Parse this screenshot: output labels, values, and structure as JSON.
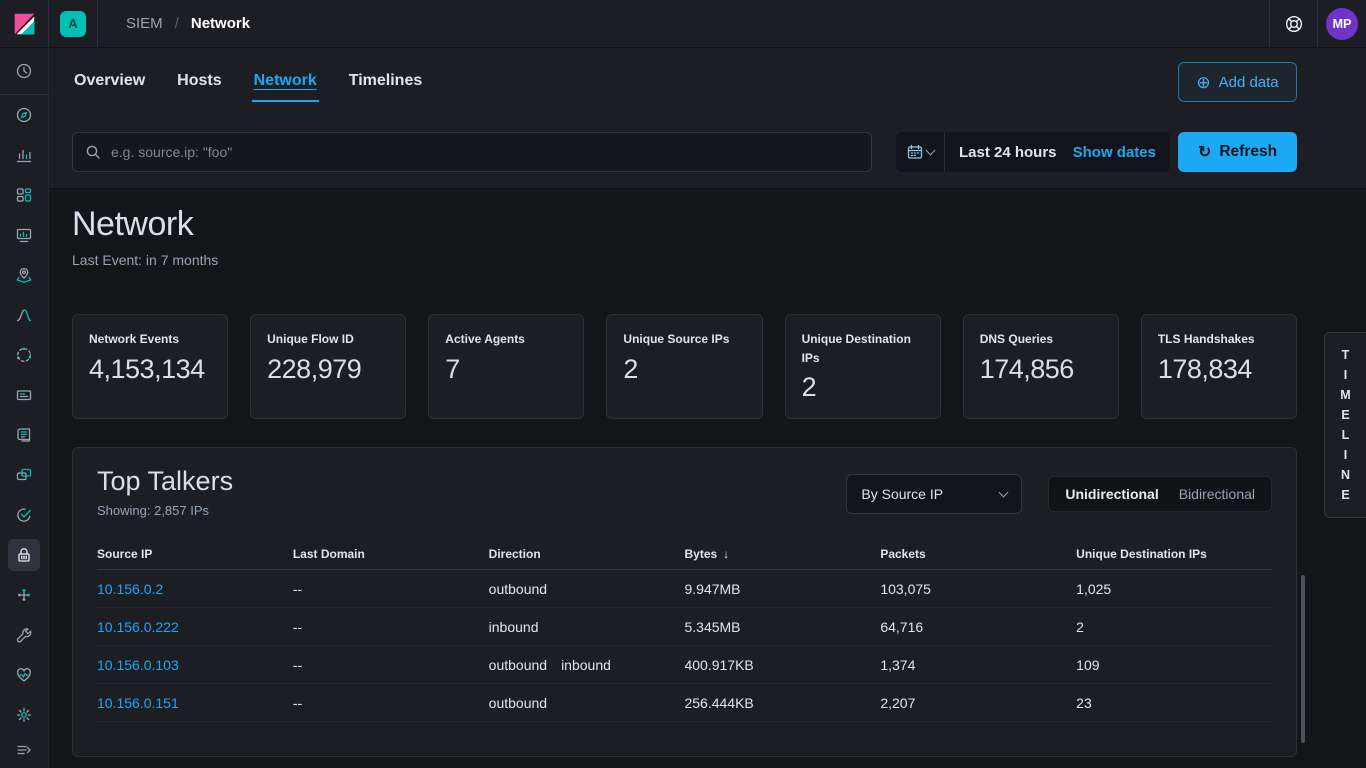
{
  "colors": {
    "accent_blue": "#1ba9f5",
    "accent_teal": "#00bfb3",
    "logo_pink": "#f04e98",
    "avatar_purple": "#6e35c8",
    "panel_bg": "#1d1e24",
    "page_bg": "#141519"
  },
  "topbar": {
    "space_badge": "A",
    "breadcrumb": {
      "parent": "SIEM",
      "separator": "/",
      "current": "Network"
    },
    "avatar": "MP"
  },
  "tabs": [
    "Overview",
    "Hosts",
    "Network",
    "Timelines"
  ],
  "add_data": {
    "icon": "⊕",
    "label": "Add data"
  },
  "search": {
    "placeholder": "e.g. source.ip: \"foo\""
  },
  "datepicker": {
    "range_label": "Last 24 hours",
    "show_dates_label": "Show dates"
  },
  "refresh": {
    "icon": "↻",
    "label": "Refresh"
  },
  "page": {
    "title": "Network",
    "subtitle": "Last Event: in 7 months"
  },
  "stats": [
    {
      "label": "Network Events",
      "value": "4,153,134"
    },
    {
      "label": "Unique Flow ID",
      "value": "228,979"
    },
    {
      "label": "Active Agents",
      "value": "7"
    },
    {
      "label": "Unique Source IPs",
      "value": "2"
    },
    {
      "label": "Unique Destination IPs",
      "value": "2"
    },
    {
      "label": "DNS Queries",
      "value": "174,856"
    },
    {
      "label": "TLS Handshakes",
      "value": "178,834"
    }
  ],
  "timeline": {
    "letters": [
      "T",
      "I",
      "M",
      "E",
      "L",
      "I",
      "N",
      "E"
    ]
  },
  "top_talkers": {
    "title": "Top Talkers",
    "subtitle": "Showing: 2,857 IPs",
    "group_by": "By Source IP",
    "toggle": {
      "active": "Unidirectional",
      "inactive": "Bidirectional"
    },
    "columns": [
      "Source IP",
      "Last Domain",
      "Direction",
      "Bytes",
      "Packets",
      "Unique Destination IPs"
    ],
    "sort_icon": "↓",
    "rows": [
      {
        "source_ip": "10.156.0.2",
        "last_domain": "--",
        "direction": "outbound",
        "direction2": "",
        "bytes": "9.947MB",
        "packets": "103,075",
        "unique_destination_ips": "1,025"
      },
      {
        "source_ip": "10.156.0.222",
        "last_domain": "--",
        "direction": "inbound",
        "direction2": "",
        "bytes": "5.345MB",
        "packets": "64,716",
        "unique_destination_ips": "2"
      },
      {
        "source_ip": "10.156.0.103",
        "last_domain": "--",
        "direction": "outbound",
        "direction2": "inbound",
        "bytes": "400.917KB",
        "packets": "1,374",
        "unique_destination_ips": "109"
      },
      {
        "source_ip": "10.156.0.151",
        "last_domain": "--",
        "direction": "outbound",
        "direction2": "",
        "bytes": "256.444KB",
        "packets": "2,207",
        "unique_destination_ips": "23"
      }
    ]
  }
}
